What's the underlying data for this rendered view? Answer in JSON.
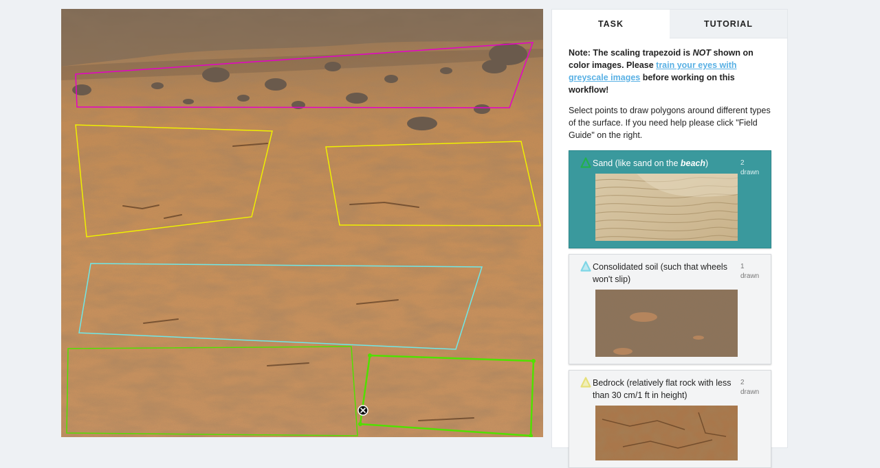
{
  "tabs": [
    {
      "label": "TASK",
      "active": true
    },
    {
      "label": "TUTORIAL",
      "active": false
    }
  ],
  "task": {
    "note_prefix": "Note: The scaling trapezoid is ",
    "note_emphasis": "NOT",
    "note_middle": " shown on color images. Please ",
    "note_link": "train your eyes with greyscale images",
    "note_suffix": " before working on this workflow!",
    "instructions": "Select points to draw polygons around different types of the surface. If you need help please click \"Field Guide\" on the right."
  },
  "answers": [
    {
      "label_prefix": "Sand (like sand on the ",
      "label_emphasis": "beach",
      "label_suffix": ")",
      "count": "2",
      "count_unit": "drawn",
      "color": "#22b14c",
      "selected": true,
      "image": "sand-dunes-photo"
    },
    {
      "label": "Consolidated soil (such that wheels won't slip)",
      "count": "1",
      "count_unit": "drawn",
      "color": "#7fd6e6",
      "selected": false,
      "image": "consolidated-soil-photo"
    },
    {
      "label": "Bedrock (relatively flat rock with less than 30 cm/1 ft in height)",
      "count": "2",
      "count_unit": "drawn",
      "color": "#e6e07a",
      "selected": false,
      "image": "bedrock-photo"
    }
  ],
  "drawing": {
    "colors": {
      "rocks": "#e600c8",
      "bedrock": "#f0f000",
      "consolidated": "#70e8e8",
      "sand": "#50e000"
    },
    "delete_icon": "delete-mark-icon"
  }
}
